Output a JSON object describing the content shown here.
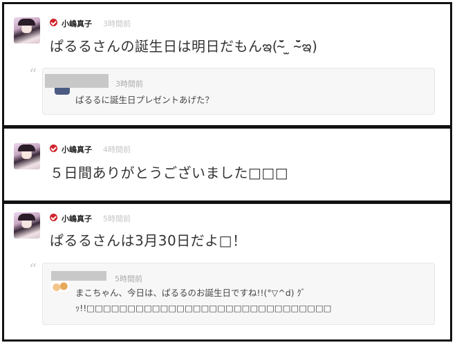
{
  "posts": [
    {
      "author": "小嶋真子",
      "time": "3時間前",
      "body": "ぱるるさんの誕生日は明日だもんఇ(¯̴̆ ̫ ¯̴̆ఇ)",
      "quote": {
        "time": "3時間前",
        "lines": [
          "ぱるるに誕生日プレゼントあげた？"
        ]
      }
    },
    {
      "author": "小嶋真子",
      "time": "4時間前",
      "body": "５日間ありがとうございました□□□"
    },
    {
      "author": "小嶋真子",
      "time": "5時間前",
      "body": "ぱるるさんは3月30日だよ□！",
      "quote": {
        "time": "5時間前",
        "lines": [
          "まこちゃん、今日は、ぱるるのお誕生日ですね!!(°▽^d) ｸﾞ",
          "ｯ!!□□□□□□□□□□□□□□□□□□□□□□□□□□□□□□"
        ]
      }
    }
  ],
  "quote_mark": "“",
  "colors": {
    "verified": "#d0232c",
    "time": "#c4c4c4",
    "border": "#111111",
    "quote_bg": "#f7f7f7"
  }
}
